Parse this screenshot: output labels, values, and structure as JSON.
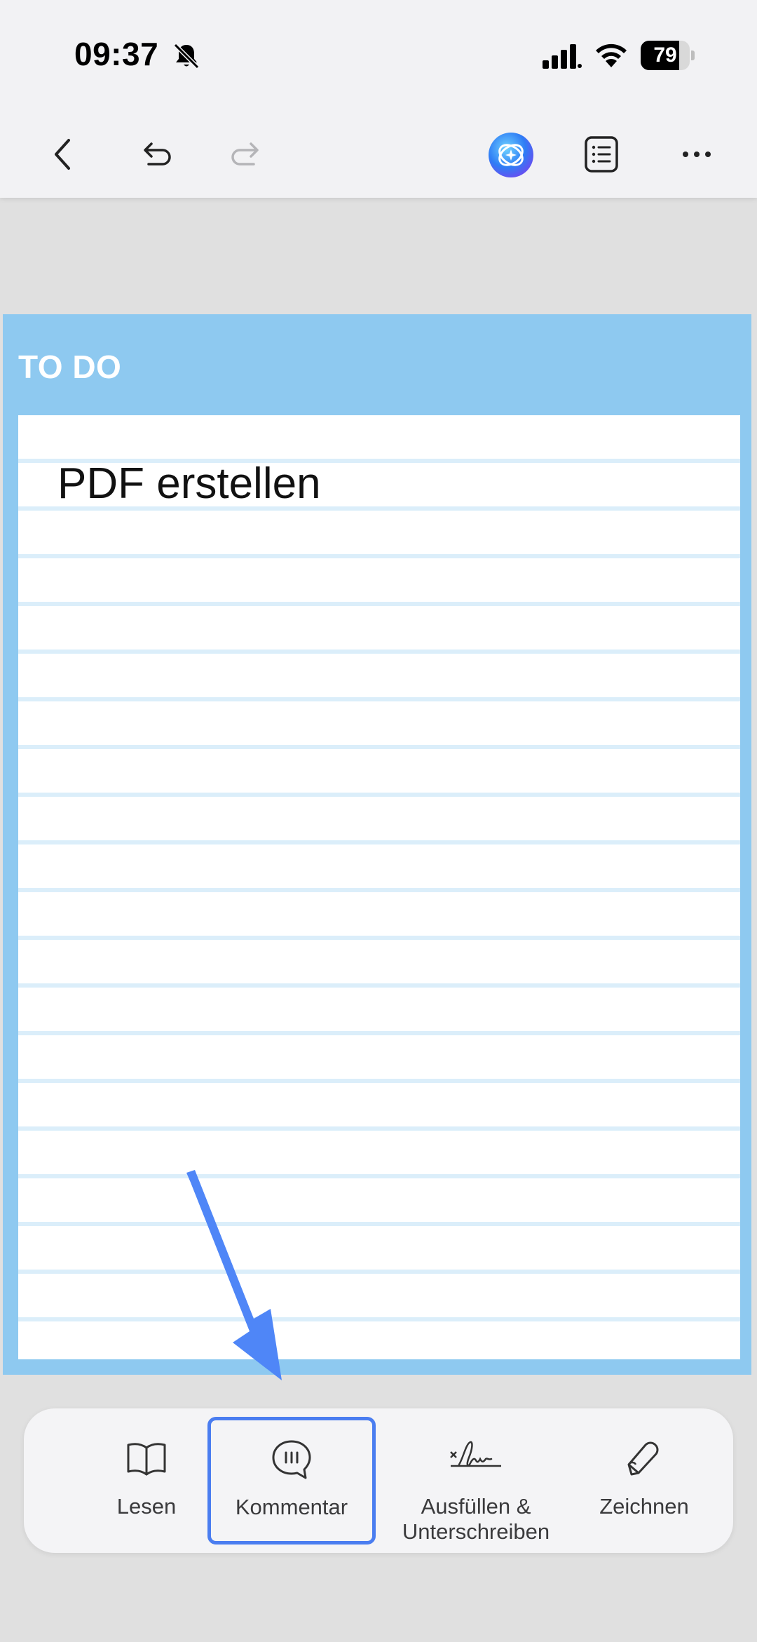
{
  "status_bar": {
    "time": "09:37",
    "battery_percent": "79",
    "battery_level": 0.79
  },
  "toolbar": {
    "icons": [
      "back-chevron-icon",
      "undo-icon",
      "redo-icon",
      "ai-assistant-icon",
      "list-icon",
      "more-icon"
    ]
  },
  "document": {
    "title": "TO DO",
    "note": "PDF erstellen",
    "header_color": "#8ec9f0"
  },
  "tabbar": {
    "tabs": [
      {
        "label": "Lesen",
        "icon": "book-icon"
      },
      {
        "label": "Kommentar",
        "icon": "comment-icon",
        "selected": true
      },
      {
        "label_line1": "Ausfüllen &",
        "label_line2": "Unterschreiben",
        "icon": "signature-icon"
      },
      {
        "label": "Zeichnen",
        "icon": "pen-icon"
      }
    ]
  },
  "colors": {
    "highlight": "#4a7df0",
    "arrow": "#4f86f7"
  }
}
